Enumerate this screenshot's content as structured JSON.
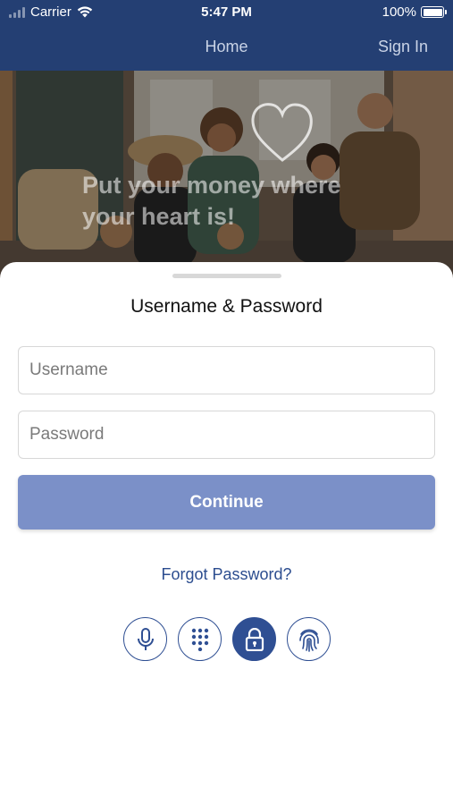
{
  "status_bar": {
    "carrier": "Carrier",
    "time": "5:47 PM",
    "battery": "100%"
  },
  "nav": {
    "title": "Home",
    "sign_in": "Sign In"
  },
  "hero": {
    "tagline": "Put your money where your heart is!"
  },
  "login": {
    "title": "Username & Password",
    "username_placeholder": "Username",
    "password_placeholder": "Password",
    "continue_label": "Continue",
    "forgot_label": "Forgot Password?"
  },
  "auth_methods": [
    {
      "icon": "microphone-icon",
      "active": false
    },
    {
      "icon": "keypad-icon",
      "active": false
    },
    {
      "icon": "lock-icon",
      "active": true
    },
    {
      "icon": "fingerprint-icon",
      "active": false
    }
  ],
  "colors": {
    "header": "#243f73",
    "accent": "#2f4f93",
    "button": "#7b90c8",
    "link": "#2c4d8f"
  }
}
